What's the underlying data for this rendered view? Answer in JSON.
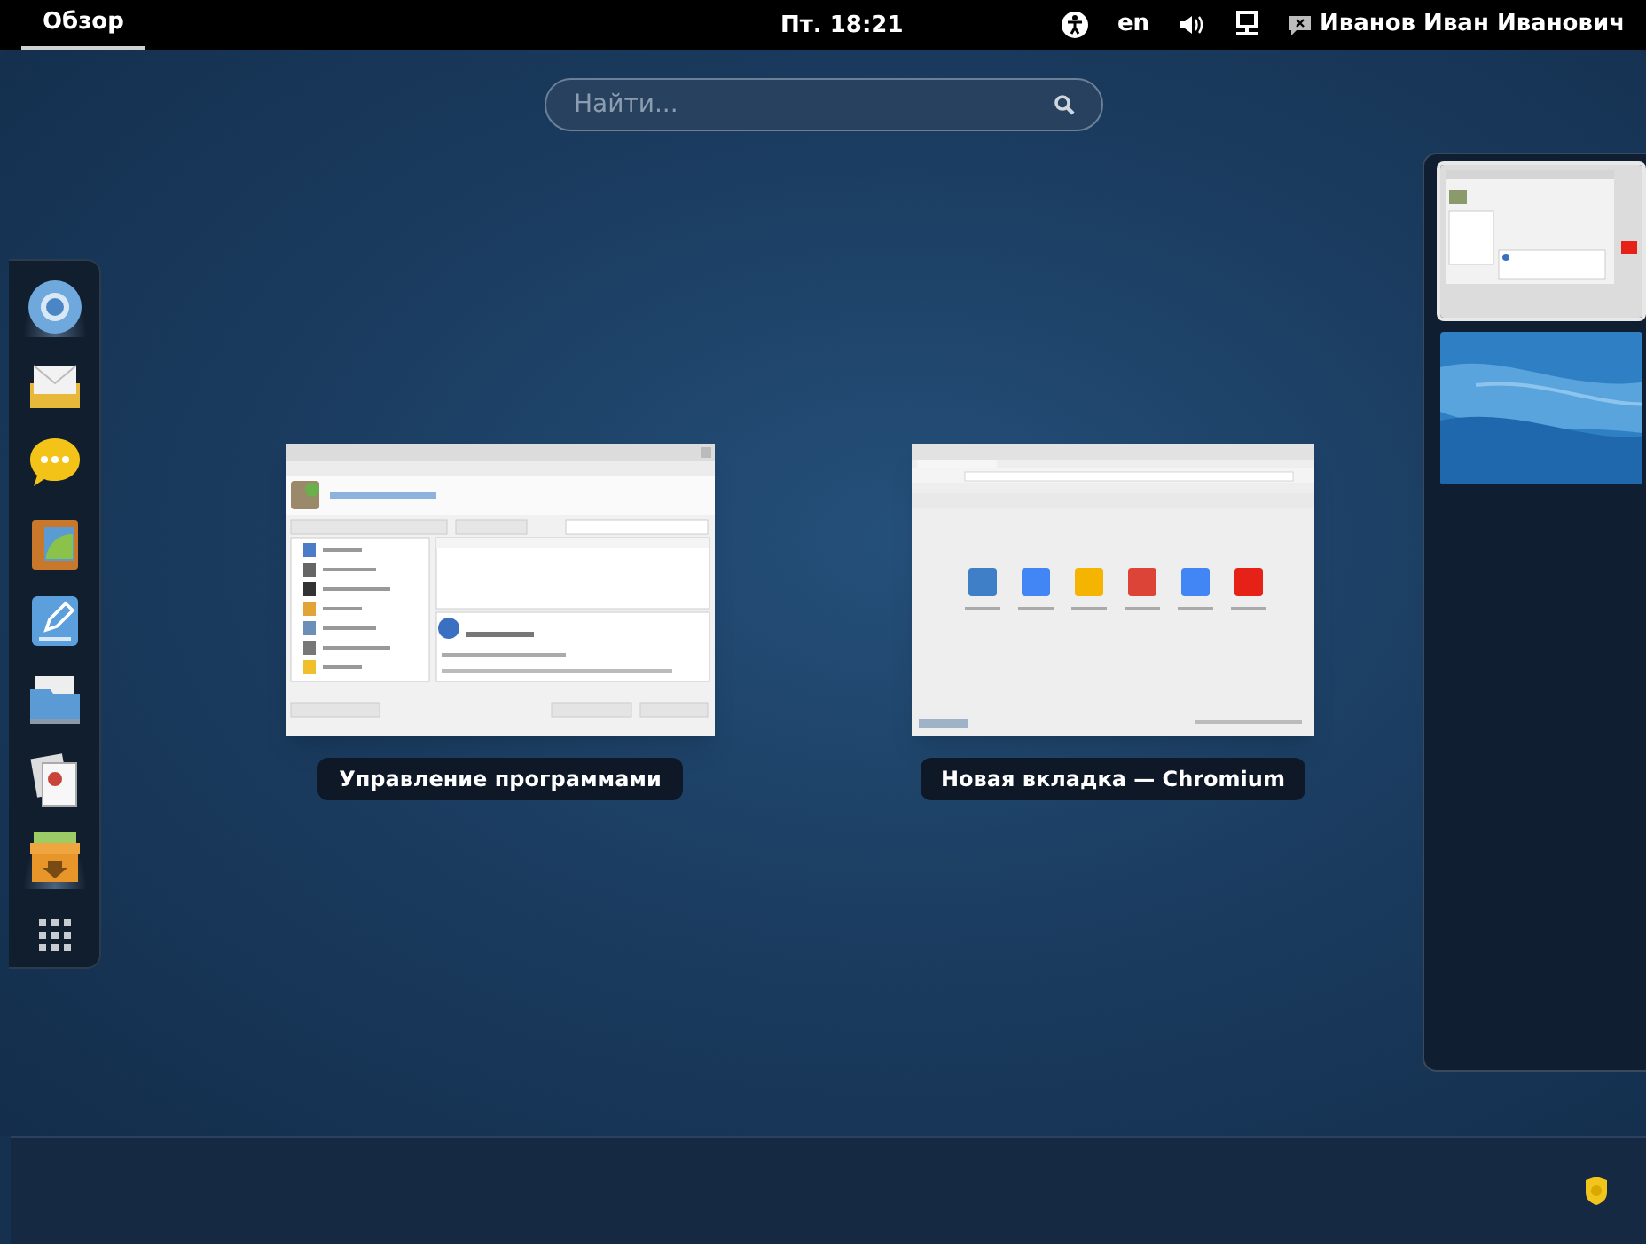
{
  "top_bar": {
    "activities": {
      "label": "Обзор",
      "selected": true
    },
    "clock": "Пт. 18:21",
    "keyboard_layout": "en",
    "user_name": "Иванов Иван Иванович"
  },
  "search": {
    "placeholder": "Найти..."
  },
  "dash": {
    "items": [
      {
        "kind": "browser",
        "running": true
      },
      {
        "kind": "mail",
        "running": false
      },
      {
        "kind": "chat",
        "running": false
      },
      {
        "kind": "photos",
        "running": false
      },
      {
        "kind": "notes",
        "running": false
      },
      {
        "kind": "files",
        "running": false
      },
      {
        "kind": "documents",
        "running": false
      },
      {
        "kind": "archive",
        "running": true
      },
      {
        "kind": "app_grid",
        "running": false
      }
    ]
  },
  "windows": [
    {
      "kind": "package_manager",
      "title": "Управление программами"
    },
    {
      "kind": "browser",
      "title": "Новая вкладка — Chromium"
    }
  ],
  "workspaces": [
    {
      "kind": "windows",
      "selected": true
    },
    {
      "kind": "empty",
      "selected": false
    }
  ]
}
